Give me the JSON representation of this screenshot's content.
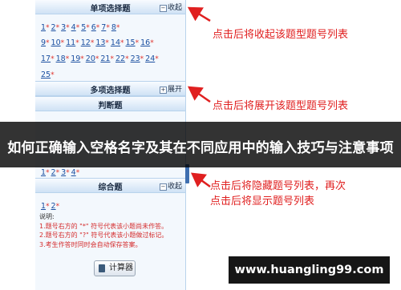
{
  "single_choice": {
    "title": "单项选择题",
    "toggle_label": "收起",
    "toggle_icon": "minus-box-icon",
    "rows": [
      [
        {
          "num": "1",
          "mark": "*"
        },
        {
          "num": "2",
          "mark": "*"
        },
        {
          "num": "3",
          "mark": "*"
        },
        {
          "num": "4",
          "mark": "*"
        },
        {
          "num": "5",
          "mark": "*"
        },
        {
          "num": "6",
          "mark": "*"
        },
        {
          "num": "7",
          "mark": "*"
        },
        {
          "num": "8",
          "mark": "*"
        }
      ],
      [
        {
          "num": "9",
          "mark": "*"
        },
        {
          "num": "10",
          "mark": "*"
        },
        {
          "num": "11",
          "mark": "*"
        },
        {
          "num": "12",
          "mark": "*"
        },
        {
          "num": "13",
          "mark": "*"
        },
        {
          "num": "14",
          "mark": "*"
        },
        {
          "num": "15",
          "mark": "*"
        },
        {
          "num": "16",
          "mark": "*"
        }
      ],
      [
        {
          "num": "17",
          "mark": "*"
        },
        {
          "num": "18",
          "mark": "*"
        },
        {
          "num": "19",
          "mark": "*"
        },
        {
          "num": "20",
          "mark": "*"
        },
        {
          "num": "21",
          "mark": "*"
        },
        {
          "num": "22",
          "mark": "*"
        },
        {
          "num": "23",
          "mark": "*"
        },
        {
          "num": "24",
          "mark": "*"
        }
      ],
      [
        {
          "num": "25",
          "mark": "*"
        }
      ]
    ]
  },
  "multi_choice": {
    "title": "多项选择题",
    "toggle_label": "展开",
    "toggle_icon": "plus-box-icon"
  },
  "true_false": {
    "title": "判断题",
    "rows": [
      [
        {
          "num": "1",
          "mark": "*"
        },
        {
          "num": "2",
          "mark": "*"
        },
        {
          "num": "3",
          "mark": "*"
        },
        {
          "num": "4",
          "mark": "*"
        }
      ]
    ]
  },
  "comprehensive": {
    "title": "综合题",
    "toggle_label": "收起",
    "toggle_icon": "minus-box-icon",
    "rows": [
      [
        {
          "num": "1",
          "mark": "*"
        },
        {
          "num": "2",
          "mark": "*"
        }
      ]
    ]
  },
  "notes": {
    "title": "说明:",
    "lines": [
      "1.题号右方的 \"*\" 符号代表该小题尚未作答。",
      "2.题号右方的 \"?\" 符号代表该小题做过标记。",
      "3.考生作答时同时会自动保存答案。"
    ]
  },
  "calculator_label": "计算器",
  "callouts": [
    "点击后将收起该题型题号列表",
    "点击后将展开该题型题号列表",
    "点击后将隐藏题号列表，再次",
    "点击后将显示题号列表"
  ],
  "banner_title": "如何正确输入空格名字及其在不同应用中的输入技巧与注意事项",
  "watermark": "www.huangling99.com",
  "colors": {
    "callout_red": "#e02020",
    "link_blue": "#1b4fa0",
    "panel_bg": "#f3f8fd",
    "header_blue": "#cfe2f5"
  }
}
